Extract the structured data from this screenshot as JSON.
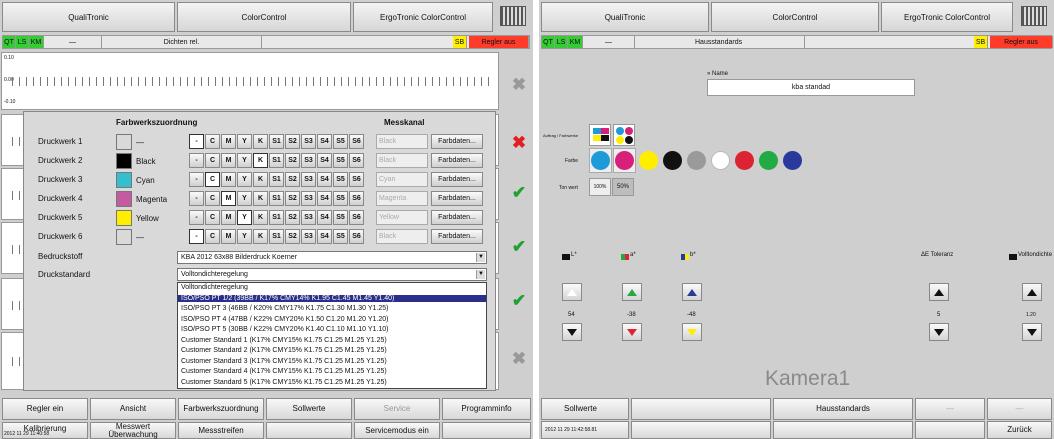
{
  "left": {
    "tabs": [
      "QualiTronic",
      "ColorControl",
      "ErgoTronic ColorControl"
    ],
    "status": {
      "qt": "QT",
      "ls": "LS",
      "km": "KM",
      "dash": "—",
      "title": "Dichten rel.",
      "sb": "SB",
      "regler": "Regler aus"
    },
    "scale_top": [
      "0.10",
      "0.00",
      "-0.10"
    ],
    "dialog": {
      "header_left": "Farbwerkszuordnung",
      "header_right": "Messkanal",
      "rows": [
        {
          "label": "Druckwerk 1",
          "swatch": "#d9d9d9",
          "color_name": "—",
          "channel": "Black"
        },
        {
          "label": "Druckwerk 2",
          "swatch": "#000000",
          "color_name": "Black",
          "channel": "Black"
        },
        {
          "label": "Druckwerk 3",
          "swatch": "#33bfcf",
          "color_name": "Cyan",
          "channel": "Cyan"
        },
        {
          "label": "Druckwerk 4",
          "swatch": "#c45aa0",
          "color_name": "Magenta",
          "channel": "Magenta"
        },
        {
          "label": "Druckwerk 5",
          "swatch": "#ffee00",
          "color_name": "Yellow",
          "channel": "Yellow"
        },
        {
          "label": "Druckwerk 6",
          "swatch": "#d9d9d9",
          "color_name": "—",
          "channel": "Black"
        }
      ],
      "keys": [
        "-",
        "C",
        "M",
        "Y",
        "K",
        "S1",
        "S2",
        "S3",
        "S4",
        "S5",
        "S6"
      ],
      "farb": "Farbdaten...",
      "bedruckstoff_label": "Bedruckstoff",
      "bedruckstoff_value": "KBA 2012 63x88 Bilderdruck Koerner",
      "druckstandard_label": "Druckstandard",
      "druckstandard_value": "Volltondichteregelung",
      "dropdown": [
        "Volltondichteregelung",
        "ISO/PSO PT 1/2   (39BB / K17% CMY14%  K1.95 C1.45 M1.45 Y1.40)",
        "ISO/PSO PT 3   (46BB / K20% CMY17%  K1.75 C1.30 M1.30 Y1.25)",
        "ISO/PSO PT 4   (47BB / K22% CMY20%  K1.50 C1.20 M1.20 Y1.20)",
        "ISO/PSO PT 5   (30BB / K22% CMY20%  K1.40 C1.10 M1.10 Y1.10)",
        "Customer Standard 1   (K17% CMY15%  K1.75 C1.25 M1.25 Y1.25)",
        "Customer Standard 2   (K17% CMY15%  K1.75 C1.25 M1.25 Y1.25)",
        "Customer Standard 3   (K17% CMY15%  K1.75 C1.25 M1.25 Y1.25)",
        "Customer Standard 4   (K17% CMY15%  K1.75 C1.25 M1.25 Y1.25)",
        "Customer Standard 5   (K17% CMY15%  K1.75 C1.25 M1.25 Y1.25)"
      ]
    },
    "bottom_row1": [
      "Regler ein",
      "Ansicht",
      "Farbwerkszuordnung",
      "Sollwerte",
      "Service",
      "Programminfo"
    ],
    "bottom_row2": [
      "Kalibrierung",
      "Messwert Überwachung",
      "Messstreifen",
      "",
      "Servicemodus ein",
      ""
    ],
    "timestamp": "2012 11 29 11:40:58"
  },
  "right": {
    "tabs": [
      "QualiTronic",
      "ColorControl",
      "ErgoTronic ColorControl"
    ],
    "status": {
      "qt": "QT",
      "ls": "LS",
      "km": "KM",
      "dash": "—",
      "title": "Hausstandards",
      "sb": "SB",
      "regler": "Regler aus"
    },
    "name_label": "» Name",
    "name_value": "kba standad",
    "row_labels": [
      "Auftrag / Farbwerke",
      "Farbe",
      "Ton wert"
    ],
    "ton_values": [
      "100%",
      "50%"
    ],
    "dots": [
      "#1e9ad6",
      "#d6207a",
      "#ffee00",
      "#111111",
      "#9a9a9a",
      "#ffffff",
      "#dd2233",
      "#22aa44",
      "#2a3a9a"
    ],
    "col_labels": [
      "L*",
      "a*",
      "b*"
    ],
    "toleranz_label": "ΔE Toleranz",
    "vollton_label": "Volltondichte",
    "values": [
      "54",
      "-38",
      "-48",
      "5",
      "1.20"
    ],
    "kamera": "Kamera1",
    "bottom_row1": [
      "Sollwerte",
      "",
      "Hausstandards",
      "—",
      "—"
    ],
    "bottom_row2": [
      "2012 11 29 11:42:58.81",
      "",
      "",
      "",
      "Zurück"
    ]
  }
}
